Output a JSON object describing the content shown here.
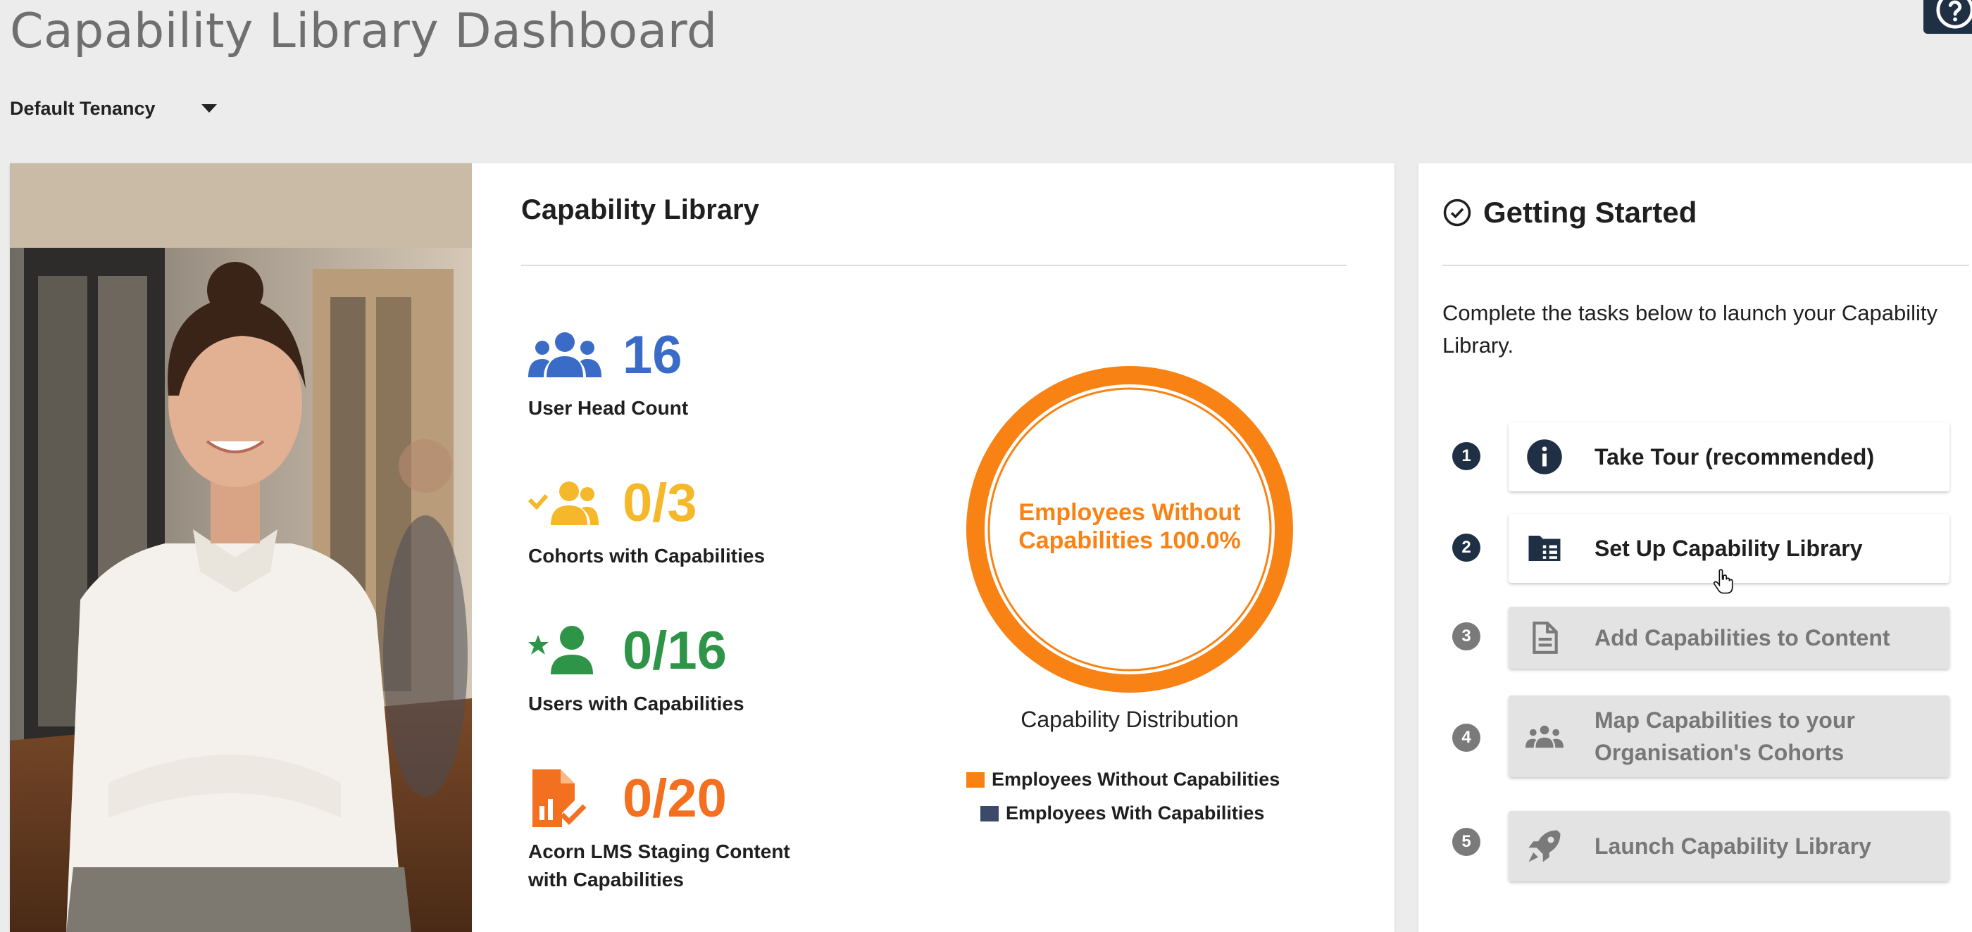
{
  "header": {
    "title": "Capability Library Dashboard",
    "help_icon": "question-circle-icon"
  },
  "tenancy": {
    "selected": "Default Tenancy"
  },
  "capability_library": {
    "title": "Capability Library",
    "stats": [
      {
        "value": "16",
        "label": "User Head Count",
        "icon": "group-icon",
        "color": "#3a6bc6"
      },
      {
        "value": "0/3",
        "label": "Cohorts with Capabilities",
        "icon": "group-check-icon",
        "color": "#f5b82a"
      },
      {
        "value": "0/16",
        "label": "Users with Capabilities",
        "icon": "person-star-icon",
        "color": "#2e9447"
      },
      {
        "value": "0/20",
        "label_line1": "Acorn LMS Staging Content",
        "label_line2": "with Capabilities",
        "icon": "document-chart-check-icon",
        "color": "#f37021"
      }
    ],
    "chart": {
      "center_text_line1": "Employees Without",
      "center_text_line2": "Capabilities 100.0%",
      "caption": "Capability Distribution",
      "legend": [
        {
          "label": "Employees Without Capabilities",
          "color": "#f98215"
        },
        {
          "label": "Employees With Capabilities",
          "color": "#3b4a6b"
        }
      ]
    }
  },
  "chart_data": {
    "type": "pie",
    "title": "Capability Distribution",
    "labels": [
      "Employees Without Capabilities",
      "Employees With Capabilities"
    ],
    "values": [
      100.0,
      0.0
    ],
    "colors": [
      "#f98215",
      "#3b4a6b"
    ],
    "legend_position": "bottom"
  },
  "getting_started": {
    "title": "Getting Started",
    "description": "Complete the tasks below to launch your Capability Library.",
    "steps": [
      {
        "number": "1",
        "label": "Take Tour (recommended)",
        "icon": "info-icon",
        "state": "active"
      },
      {
        "number": "2",
        "label": "Set Up Capability Library",
        "icon": "folder-list-icon",
        "state": "active"
      },
      {
        "number": "3",
        "label": "Add Capabilities to Content",
        "icon": "document-icon",
        "state": "disabled"
      },
      {
        "number": "4",
        "label_line1": "Map Capabilities to your",
        "label_line2": "Organisation's Cohorts",
        "icon": "groups-icon",
        "state": "disabled"
      },
      {
        "number": "5",
        "label": "Launch Capability Library",
        "icon": "rocket-icon",
        "state": "disabled"
      }
    ]
  }
}
